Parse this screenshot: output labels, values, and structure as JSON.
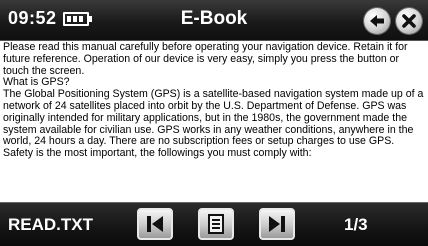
{
  "status": {
    "time": "09:52"
  },
  "header": {
    "title": "E-Book"
  },
  "content": {
    "text": "Please read this manual carefully before operating your navigation device. Retain it for future reference. Operation of our device is very easy, simply you press the button or touch the screen.\nWhat is GPS?\nThe Global Positioning System (GPS) is a satellite-based navigation system made up of a network of 24 satellites placed into orbit by the U.S. Department of Defense. GPS was originally intended for military applications, but in the 1980s, the government made the system available for civilian use. GPS works in any weather conditions, anywhere in the world, 24 hours a day. There are no subscription fees or setup charges to use GPS.\nSafety is the most important, the followings you must comply with:"
  },
  "footer": {
    "filename": "READ.TXT",
    "page": "1/3"
  },
  "icons": {
    "battery": "battery-icon",
    "back": "back-arrow-icon",
    "close": "close-icon",
    "prev": "skip-previous-icon",
    "menu": "list-icon",
    "next": "skip-next-icon"
  }
}
